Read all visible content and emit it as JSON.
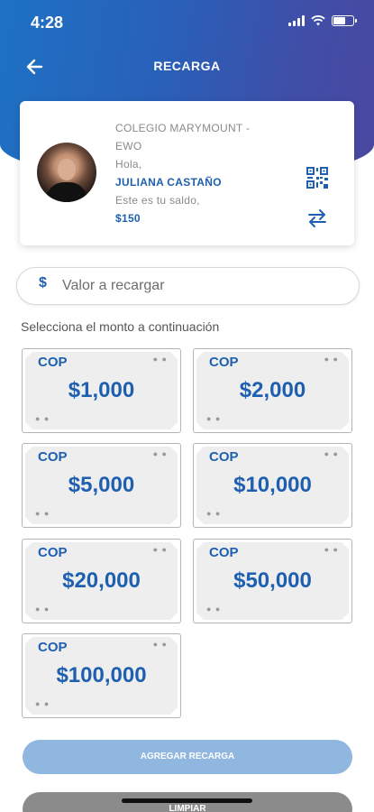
{
  "status_bar": {
    "time": "4:28"
  },
  "nav": {
    "title": "RECARGA"
  },
  "profile": {
    "school": "COLEGIO MARYMOUNT - EWO",
    "greeting": "Hola,",
    "name": "JULIANA CASTAÑO",
    "balance_label": "Este es tu saldo,",
    "balance": "$150"
  },
  "amount_input": {
    "currency_symbol": "$",
    "placeholder": "Valor a recargar"
  },
  "section_label": "Selecciona el monto a continuación",
  "bills": [
    {
      "currency": "COP",
      "amount": "$1,000"
    },
    {
      "currency": "COP",
      "amount": "$2,000"
    },
    {
      "currency": "COP",
      "amount": "$5,000"
    },
    {
      "currency": "COP",
      "amount": "$10,000"
    },
    {
      "currency": "COP",
      "amount": "$20,000"
    },
    {
      "currency": "COP",
      "amount": "$50,000"
    },
    {
      "currency": "COP",
      "amount": "$100,000"
    }
  ],
  "buttons": {
    "add": "AGREGAR RECARGA",
    "clear": "LIMPIAR"
  },
  "colors": {
    "primary": "#1e5fb0",
    "add_button": "#8fb7e0",
    "clear_button": "#8b8b8b"
  }
}
